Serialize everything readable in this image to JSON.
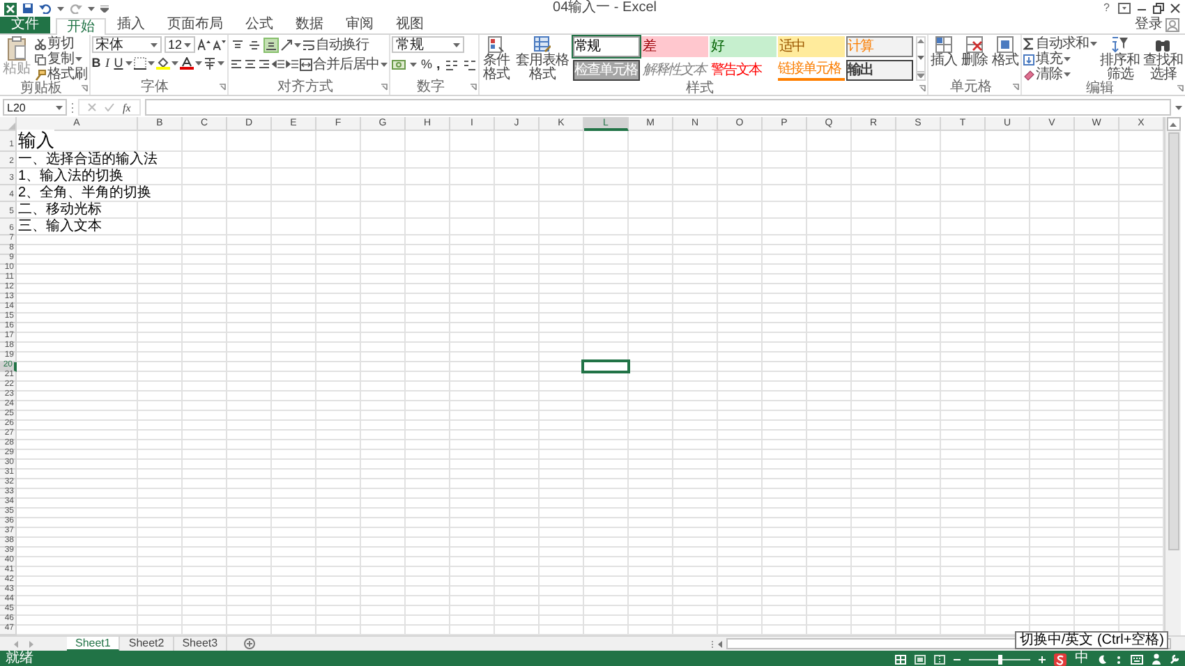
{
  "title_bar": {
    "title": "04输入一 - Excel",
    "help": "?"
  },
  "tabs": [
    {
      "label": "文件",
      "kind": "file",
      "selected": false
    },
    {
      "label": "开始",
      "kind": "tab",
      "selected": true
    },
    {
      "label": "插入",
      "kind": "tab",
      "selected": false
    },
    {
      "label": "页面布局",
      "kind": "tab",
      "selected": false
    },
    {
      "label": "公式",
      "kind": "tab",
      "selected": false
    },
    {
      "label": "数据",
      "kind": "tab",
      "selected": false
    },
    {
      "label": "审阅",
      "kind": "tab",
      "selected": false
    },
    {
      "label": "视图",
      "kind": "tab",
      "selected": false
    }
  ],
  "account": {
    "label": "登录"
  },
  "ribbon": {
    "clipboard": {
      "label": "剪贴板",
      "paste": "粘贴",
      "cut": "剪切",
      "copy": "复制",
      "format_painter": "格式刷"
    },
    "font": {
      "label": "字体",
      "font_name": "宋体",
      "font_size": "12",
      "format_buttons": [
        "B",
        "I",
        "U"
      ]
    },
    "alignment": {
      "label": "对齐方式",
      "vertical_align_buttons": [
        {
          "selected": false
        },
        {
          "selected": false
        },
        {
          "selected": true
        }
      ],
      "wrap_text": "自动换行",
      "merge_center": "合并后居中"
    },
    "number": {
      "label": "数字",
      "format": "常规",
      "percent": "%",
      "comma": ","
    },
    "styles": {
      "label": "样式",
      "conditional_formatting": "条件格式",
      "format_as_table": "套用表格格式",
      "cell_styles": [
        {
          "label": "常规",
          "kind": "normal",
          "selected": true
        },
        {
          "label": "差",
          "kind": "bad",
          "selected": false
        },
        {
          "label": "好",
          "kind": "good",
          "selected": false
        },
        {
          "label": "适中",
          "kind": "neutral",
          "selected": false
        },
        {
          "label": "计算",
          "kind": "calculation",
          "selected": false
        },
        {
          "label": "检查单元格",
          "kind": "check",
          "selected": false
        },
        {
          "label": "解释性文本",
          "kind": "explanatory",
          "selected": false
        },
        {
          "label": "警告文本",
          "kind": "warning",
          "selected": false
        },
        {
          "label": "链接单元格",
          "kind": "linked",
          "selected": false
        },
        {
          "label": "输出",
          "kind": "output",
          "selected": false
        }
      ]
    },
    "cells": {
      "label": "单元格",
      "insert": "插入",
      "delete": "删除",
      "format": "格式"
    },
    "editing": {
      "label": "编辑",
      "autosum": "自动求和",
      "fill": "填充",
      "clear": "清除",
      "sort_filter": "排序和筛选",
      "find_select": "查找和选择"
    }
  },
  "formula_bar": {
    "name_box": "L20",
    "function_label": "fx"
  },
  "columns": [
    {
      "label": "A",
      "selected": false
    },
    {
      "label": "B",
      "selected": false
    },
    {
      "label": "C",
      "selected": false
    },
    {
      "label": "D",
      "selected": false
    },
    {
      "label": "E",
      "selected": false
    },
    {
      "label": "F",
      "selected": false
    },
    {
      "label": "G",
      "selected": false
    },
    {
      "label": "H",
      "selected": false
    },
    {
      "label": "I",
      "selected": false
    },
    {
      "label": "J",
      "selected": false
    },
    {
      "label": "K",
      "selected": false
    },
    {
      "label": "L",
      "selected": true
    },
    {
      "label": "M",
      "selected": false
    },
    {
      "label": "N",
      "selected": false
    },
    {
      "label": "O",
      "selected": false
    },
    {
      "label": "P",
      "selected": false
    },
    {
      "label": "Q",
      "selected": false
    },
    {
      "label": "R",
      "selected": false
    },
    {
      "label": "S",
      "selected": false
    },
    {
      "label": "T",
      "selected": false
    },
    {
      "label": "U",
      "selected": false
    },
    {
      "label": "V",
      "selected": false
    },
    {
      "label": "W",
      "selected": false
    },
    {
      "label": "X",
      "selected": false
    }
  ],
  "rows": [
    {
      "label": "1",
      "selected": false
    },
    {
      "label": "2",
      "selected": false
    },
    {
      "label": "3",
      "selected": false
    },
    {
      "label": "4",
      "selected": false
    },
    {
      "label": "5",
      "selected": false
    },
    {
      "label": "6",
      "selected": false
    },
    {
      "label": "7",
      "selected": false
    },
    {
      "label": "8",
      "selected": false
    },
    {
      "label": "9",
      "selected": false
    },
    {
      "label": "10",
      "selected": false
    },
    {
      "label": "11",
      "selected": false
    },
    {
      "label": "12",
      "selected": false
    },
    {
      "label": "13",
      "selected": false
    },
    {
      "label": "14",
      "selected": false
    },
    {
      "label": "15",
      "selected": false
    },
    {
      "label": "16",
      "selected": false
    },
    {
      "label": "17",
      "selected": false
    },
    {
      "label": "18",
      "selected": false
    },
    {
      "label": "19",
      "selected": false
    },
    {
      "label": "20",
      "selected": true
    },
    {
      "label": "21",
      "selected": false
    },
    {
      "label": "22",
      "selected": false
    },
    {
      "label": "23",
      "selected": false
    },
    {
      "label": "24",
      "selected": false
    },
    {
      "label": "25",
      "selected": false
    },
    {
      "label": "26",
      "selected": false
    },
    {
      "label": "27",
      "selected": false
    },
    {
      "label": "28",
      "selected": false
    },
    {
      "label": "29",
      "selected": false
    },
    {
      "label": "30",
      "selected": false
    },
    {
      "label": "31",
      "selected": false
    },
    {
      "label": "32",
      "selected": false
    },
    {
      "label": "33",
      "selected": false
    },
    {
      "label": "34",
      "selected": false
    },
    {
      "label": "35",
      "selected": false
    },
    {
      "label": "36",
      "selected": false
    },
    {
      "label": "37",
      "selected": false
    },
    {
      "label": "38",
      "selected": false
    },
    {
      "label": "39",
      "selected": false
    },
    {
      "label": "40",
      "selected": false
    },
    {
      "label": "41",
      "selected": false
    },
    {
      "label": "42",
      "selected": false
    },
    {
      "label": "43",
      "selected": false
    },
    {
      "label": "44",
      "selected": false
    },
    {
      "label": "45",
      "selected": false
    },
    {
      "label": "46",
      "selected": false
    },
    {
      "label": "47",
      "selected": false
    }
  ],
  "column_a_cells": [
    {
      "text": "输入",
      "kind": "heading"
    },
    {
      "text": "一、选择合适的输入法",
      "kind": "plain"
    },
    {
      "text": "1、输入法的切换",
      "kind": "plain"
    },
    {
      "text": "2、全角、半角的切换",
      "kind": "plain"
    },
    {
      "text": "二、移动光标",
      "kind": "plain"
    },
    {
      "text": "三、输入文本",
      "kind": "plain"
    }
  ],
  "sheet_tabs": [
    {
      "label": "Sheet1",
      "selected": true
    },
    {
      "label": "Sheet2",
      "selected": false
    },
    {
      "label": "Sheet3",
      "selected": false
    }
  ],
  "status_bar": {
    "text": "就绪",
    "zoom": {
      "level": 0.5
    },
    "ime_mode": "中"
  },
  "tooltip": "切换中/英文 (Ctrl+空格)"
}
